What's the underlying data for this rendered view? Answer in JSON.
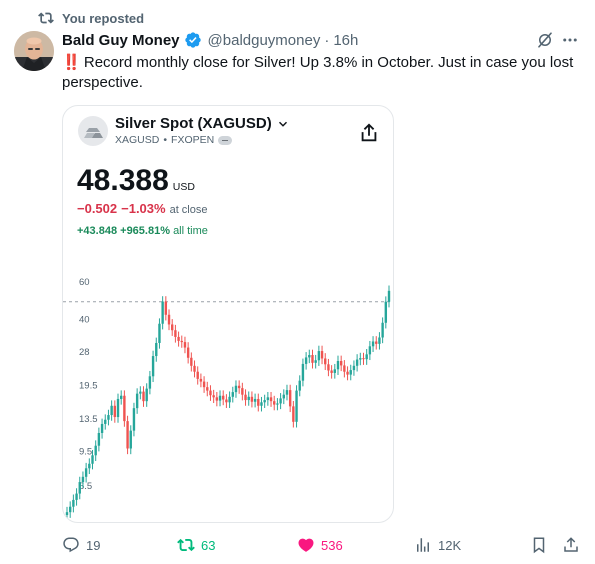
{
  "repost": {
    "label": "You reposted"
  },
  "tweet": {
    "author_name": "Bald Guy Money",
    "handle": "@baldguymoney",
    "separator": "·",
    "time": "16h",
    "alert_emoji": "‼️",
    "text": "Record monthly close for Silver! Up 3.8% in October. Just in case you lost perspective."
  },
  "card": {
    "title": "Silver Spot (XAGUSD)",
    "symbol": "XAGUSD",
    "sub_separator": "•",
    "exchange": "FXOPEN",
    "price": "48.388",
    "currency": "USD",
    "change_abs": "−0.502",
    "change_pct": "−1.03%",
    "change_label": "at close",
    "alltime_abs": "+43.848",
    "alltime_pct": "+965.81%",
    "alltime_label": "all time"
  },
  "chart_data": {
    "type": "line",
    "scale": "log",
    "y_ticks": [
      "60",
      "40",
      "28",
      "19.5",
      "13.5",
      "9.5",
      "6.5"
    ],
    "ylim": [
      4.5,
      60
    ],
    "reference_line": 48.388,
    "series": [
      {
        "values": [
          4.9,
          5.2,
          5.6,
          6.0,
          6.8,
          7.2,
          7.9,
          8.3,
          9.1,
          10.1,
          11.6,
          12.8,
          13.4,
          14.1,
          15.6,
          13.8,
          16.8,
          17.4,
          13.2,
          9.8,
          11.9,
          15.2,
          17.8,
          18.2,
          16.4,
          18.8,
          21.5,
          26.8,
          30.9,
          38.1,
          48.5,
          42.0,
          37.8,
          35.5,
          33.0,
          31.6,
          31.2,
          29.4,
          26.3,
          24.1,
          22.6,
          20.9,
          20.3,
          19.1,
          18.4,
          17.5,
          17.1,
          16.5,
          17.4,
          16.7,
          16.2,
          17.2,
          18.1,
          19.4,
          18.9,
          17.6,
          16.6,
          17.2,
          16.3,
          16.8,
          15.6,
          16.2,
          16.6,
          17.1,
          16.4,
          15.8,
          16.0,
          16.9,
          17.6,
          18.5,
          15.5,
          13.1,
          18.4,
          20.5,
          24.6,
          26.4,
          27.1,
          24.9,
          25.6,
          28.3,
          26.1,
          24.5,
          22.9,
          22.3,
          23.2,
          25.4,
          24.2,
          22.6,
          21.9,
          23.0,
          24.1,
          25.8,
          26.2,
          25.9,
          27.3,
          29.8,
          31.4,
          30.6,
          32.8,
          38.5,
          48.4,
          54.5
        ]
      }
    ]
  },
  "actions": {
    "replies": "19",
    "reposts": "63",
    "likes": "536",
    "views": "12K"
  },
  "colors": {
    "repost_green": "#00ba7c",
    "like_pink": "#f91880",
    "up": "#26a69a",
    "down": "#ef5350"
  }
}
